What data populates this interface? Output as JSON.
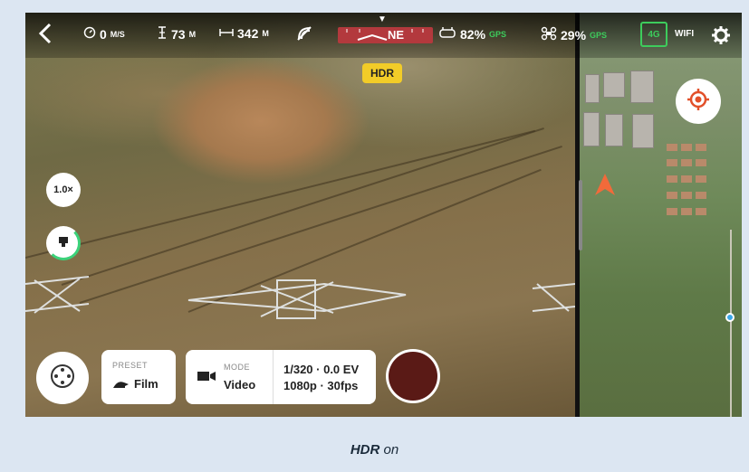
{
  "topbar": {
    "speed_value": "0",
    "speed_unit": "M/S",
    "altitude_value": "73",
    "altitude_unit": "M",
    "distance_value": "342",
    "distance_unit": "M",
    "compass_heading": "NE",
    "remote_battery": "82%",
    "gps_label_1": "GPS",
    "drone_battery": "29%",
    "gps_label_2": "GPS",
    "lte_label": "4G",
    "wifi_label": "WIFI"
  },
  "overlay": {
    "hdr_badge": "HDR",
    "zoom_label": "1.0×"
  },
  "bottom": {
    "preset_title": "PRESET",
    "preset_value": "Film",
    "mode_title": "MODE",
    "mode_value": "Video",
    "exposure_line1": "1/320 · 0.0 EV",
    "exposure_line2": "1080p · 30fps"
  },
  "caption": {
    "bold": "HDR",
    "rest": " on"
  },
  "colors": {
    "hdr_badge": "#f2cc28",
    "record_button": "#5a1a16",
    "compass_bar": "#b3393d",
    "gps_green": "#3dcc5c",
    "aircraft_marker": "#f26a3a",
    "page_background": "#dce6f2"
  },
  "icons": {
    "back": "chevron-left-icon",
    "speed": "speedometer-icon",
    "altitude": "altitude-icon",
    "distance": "distance-icon",
    "obstacle": "obstacle-avoidance-off-icon",
    "remote": "remote-controller-icon",
    "drone": "drone-icon",
    "settings": "gear-icon",
    "locate": "locate-target-icon",
    "aircraft": "aircraft-arrow-icon",
    "joystick": "joystick-icon",
    "preset": "turtle-icon",
    "mode": "video-camera-icon",
    "gimbal": "gimbal-icon"
  }
}
